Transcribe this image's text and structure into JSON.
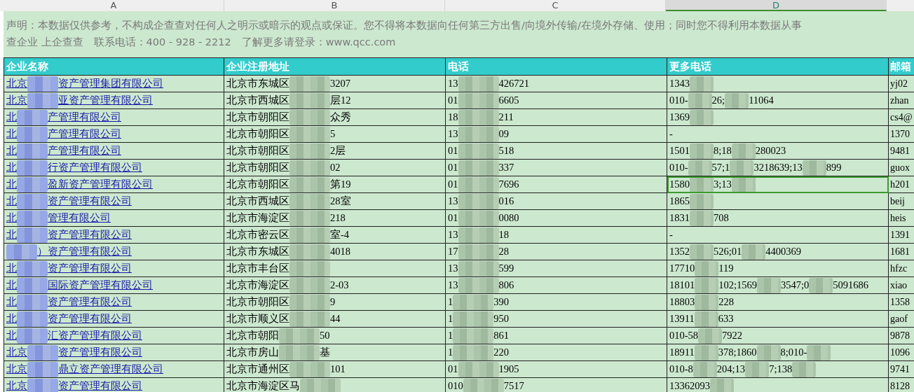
{
  "column_letters": [
    {
      "label": "A",
      "selected": false
    },
    {
      "label": "B",
      "selected": false
    },
    {
      "label": "C",
      "selected": false
    },
    {
      "label": "D",
      "selected": true
    }
  ],
  "disclaimer": [
    "声明：本数据仅供参考，不构成企查查对任何人之明示或暗示的观点或保证。您不得将本数据向任何第三方出售/向境外传输/在境外存储、使用；同时您不得利用本数据从事",
    "查企业  上企查查　联系电话：400 - 928 - 2212　了解更多请登录：www.qcc.com"
  ],
  "columns": [
    "企业名称",
    "企业注册地址",
    "电话",
    "更多电话",
    "邮箱"
  ],
  "rows": [
    {
      "selected": false,
      "cells": [
        {
          "parts": [
            "北京",
            "资产管理集团有限公司"
          ]
        },
        {
          "parts": [
            "北京市东城区",
            "3207"
          ]
        },
        {
          "parts": [
            "13",
            "426721"
          ]
        },
        {
          "parts": [
            "1343"
          ],
          "blur_end": true
        },
        {
          "parts": [
            "yj02"
          ]
        }
      ]
    },
    {
      "selected": false,
      "cells": [
        {
          "parts": [
            "北京",
            "亚资产管理有限公司"
          ]
        },
        {
          "parts": [
            "北京市西城区",
            "层12"
          ]
        },
        {
          "parts": [
            "01",
            "6605"
          ]
        },
        {
          "parts": [
            "010-",
            "26;",
            "11064"
          ]
        },
        {
          "parts": [
            "zhan"
          ]
        }
      ]
    },
    {
      "selected": false,
      "cells": [
        {
          "parts": [
            "北",
            "产管理有限公司"
          ]
        },
        {
          "parts": [
            "北京市朝阳区",
            "众秀"
          ]
        },
        {
          "parts": [
            "18",
            "211"
          ]
        },
        {
          "parts": [
            "1369"
          ],
          "blur_end": true
        },
        {
          "parts": [
            "cs4@"
          ]
        }
      ]
    },
    {
      "selected": false,
      "cells": [
        {
          "parts": [
            "北",
            "产管理有限公司"
          ]
        },
        {
          "parts": [
            "北京市朝阳区",
            "5"
          ]
        },
        {
          "parts": [
            "13",
            "09"
          ]
        },
        {
          "parts": [
            "-"
          ]
        },
        {
          "parts": [
            "1370"
          ]
        }
      ]
    },
    {
      "selected": false,
      "cells": [
        {
          "parts": [
            "北",
            "产管理有限公司"
          ]
        },
        {
          "parts": [
            "北京市朝阳区",
            "2层"
          ]
        },
        {
          "parts": [
            "01",
            "518"
          ]
        },
        {
          "parts": [
            "1501",
            "8;18",
            "280023"
          ]
        },
        {
          "parts": [
            "9481"
          ]
        }
      ]
    },
    {
      "selected": false,
      "cells": [
        {
          "parts": [
            "北",
            "行资产管理有限公司"
          ]
        },
        {
          "parts": [
            "北京市朝阳区",
            "02"
          ]
        },
        {
          "parts": [
            "01",
            "337"
          ]
        },
        {
          "parts": [
            "010-",
            "57;1",
            "3218639;13",
            "899"
          ]
        },
        {
          "parts": [
            "guox"
          ]
        }
      ]
    },
    {
      "selected": true,
      "cells": [
        {
          "parts": [
            "北",
            "盈新资产管理有限公司"
          ]
        },
        {
          "parts": [
            "北京市朝阳区",
            "第19"
          ]
        },
        {
          "parts": [
            "01",
            "7696"
          ]
        },
        {
          "parts": [
            "1580",
            "3;13"
          ],
          "blur_end": true
        },
        {
          "parts": [
            "h201"
          ]
        }
      ]
    },
    {
      "selected": false,
      "cells": [
        {
          "parts": [
            "北",
            "资产管理有限公司"
          ]
        },
        {
          "parts": [
            "北京市西城区",
            "28室"
          ]
        },
        {
          "parts": [
            "13",
            "016"
          ]
        },
        {
          "parts": [
            "1865"
          ],
          "blur_end": true
        },
        {
          "parts": [
            "beij"
          ]
        }
      ]
    },
    {
      "selected": false,
      "cells": [
        {
          "parts": [
            "北",
            "管理有限公司"
          ]
        },
        {
          "parts": [
            "北京市海淀区",
            "218"
          ]
        },
        {
          "parts": [
            "01",
            "0080"
          ]
        },
        {
          "parts": [
            "1831",
            "708"
          ]
        },
        {
          "parts": [
            "heis"
          ]
        }
      ]
    },
    {
      "selected": false,
      "cells": [
        {
          "parts": [
            "北",
            "资产管理有限公司"
          ]
        },
        {
          "parts": [
            "北京市密云区",
            "室-4"
          ]
        },
        {
          "parts": [
            "13",
            "18"
          ]
        },
        {
          "parts": [
            "-"
          ]
        },
        {
          "parts": [
            "1391"
          ]
        }
      ]
    },
    {
      "selected": false,
      "cells": [
        {
          "parts": [
            "）资产管理有限公司"
          ],
          "blur_start": true
        },
        {
          "parts": [
            "北京市东城区",
            "4018"
          ]
        },
        {
          "parts": [
            "17",
            "28"
          ]
        },
        {
          "parts": [
            "1352",
            "526;01",
            "4400369"
          ]
        },
        {
          "parts": [
            "1681"
          ]
        }
      ]
    },
    {
      "selected": false,
      "cells": [
        {
          "parts": [
            "北",
            "资产管理有限公司"
          ]
        },
        {
          "parts": [
            "北京市丰台区"
          ],
          "blur_end": true
        },
        {
          "parts": [
            "13",
            "599"
          ]
        },
        {
          "parts": [
            "17710",
            "119"
          ]
        },
        {
          "parts": [
            "hfzc"
          ]
        }
      ]
    },
    {
      "selected": false,
      "cells": [
        {
          "parts": [
            "北",
            "国际资产管理有限公司"
          ]
        },
        {
          "parts": [
            "北京市海淀区",
            "2-03"
          ]
        },
        {
          "parts": [
            "13",
            "806"
          ]
        },
        {
          "parts": [
            "18101",
            "102;1569",
            "3547;0",
            "5091686"
          ]
        },
        {
          "parts": [
            "xiao"
          ]
        }
      ]
    },
    {
      "selected": false,
      "cells": [
        {
          "parts": [
            "北",
            "资产管理有限公司"
          ]
        },
        {
          "parts": [
            "北京市朝阳区",
            "9"
          ]
        },
        {
          "parts": [
            "1",
            "390"
          ]
        },
        {
          "parts": [
            "18803",
            "228"
          ]
        },
        {
          "parts": [
            "1358"
          ]
        }
      ]
    },
    {
      "selected": false,
      "cells": [
        {
          "parts": [
            "北",
            "资产管理有限公司"
          ]
        },
        {
          "parts": [
            "北京市顺义区",
            "44"
          ]
        },
        {
          "parts": [
            "1",
            "950"
          ]
        },
        {
          "parts": [
            "13911",
            "633"
          ]
        },
        {
          "parts": [
            "gaof"
          ]
        }
      ]
    },
    {
      "selected": false,
      "cells": [
        {
          "parts": [
            "北",
            "汇资产管理有限公司"
          ]
        },
        {
          "parts": [
            "北京市朝阳",
            "50"
          ]
        },
        {
          "parts": [
            "1",
            "861"
          ]
        },
        {
          "parts": [
            "010-58",
            "7922"
          ]
        },
        {
          "parts": [
            "9878"
          ]
        }
      ]
    },
    {
      "selected": false,
      "cells": [
        {
          "parts": [
            "北京",
            "资产管理有限公司"
          ]
        },
        {
          "parts": [
            "北京市房山",
            "基"
          ]
        },
        {
          "parts": [
            "1",
            "220"
          ]
        },
        {
          "parts": [
            "18911",
            "378;1860",
            "8;010-"
          ],
          "blur_end": true
        },
        {
          "parts": [
            "1096"
          ]
        }
      ]
    },
    {
      "selected": false,
      "cells": [
        {
          "parts": [
            "北京",
            "鼎立资产管理有限公司"
          ]
        },
        {
          "parts": [
            "北京市通州区",
            "101"
          ]
        },
        {
          "parts": [
            "01",
            "1905"
          ]
        },
        {
          "parts": [
            "010-8",
            "204;13",
            "7;138"
          ],
          "blur_end": true
        },
        {
          "parts": [
            "9741"
          ]
        }
      ]
    },
    {
      "selected": false,
      "cells": [
        {
          "parts": [
            "北京",
            "资产管理有限公司"
          ]
        },
        {
          "parts": [
            "北京市海淀区马"
          ],
          "blur_end": true
        },
        {
          "parts": [
            "010",
            "7517"
          ]
        },
        {
          "parts": [
            "13362093"
          ],
          "blur_end": true
        },
        {
          "parts": [
            "8128"
          ]
        }
      ]
    }
  ]
}
